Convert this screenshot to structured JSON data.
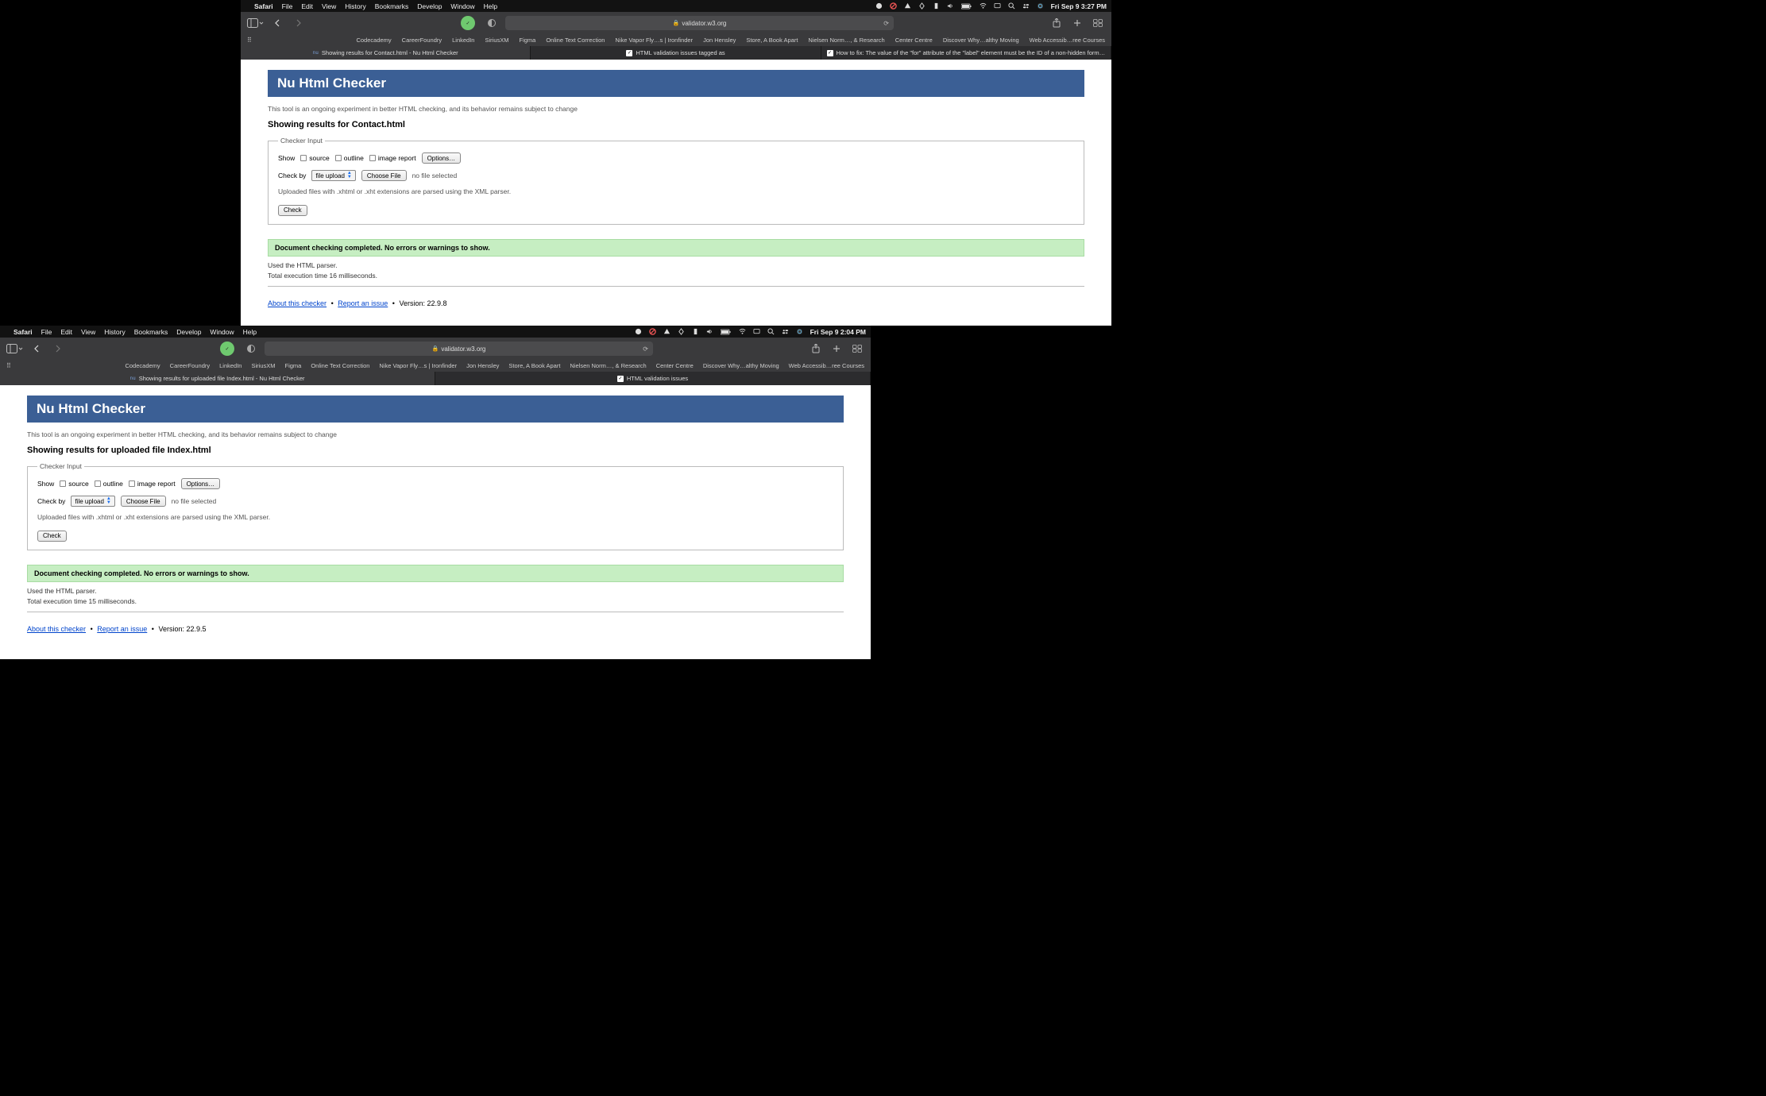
{
  "menubar": {
    "app": "Safari",
    "items": [
      "File",
      "Edit",
      "View",
      "History",
      "Bookmarks",
      "Develop",
      "Window",
      "Help"
    ]
  },
  "datetime1": "Fri Sep 9  3:27 PM",
  "datetime2": "Fri Sep 9  2:04 PM",
  "url": "validator.w3.org",
  "favorites": [
    "Codecademy",
    "CareerFoundry",
    "LinkedIn",
    "SiriusXM",
    "Figma",
    "Online Text Correction",
    "Nike Vapor Fly…s | Ironfinder",
    "Jon Hensley",
    "Store, A Book Apart",
    "Nielsen Norm…, & Research",
    "Center Centre",
    "Discover Why…althy Moving",
    "Web Accessib…ree Courses"
  ],
  "tabs1": [
    {
      "label": "Showing results for Contact.html - Nu Html Checker",
      "kind": "nu",
      "active": true
    },
    {
      "label": "HTML validation issues tagged as",
      "kind": "check",
      "active": false
    },
    {
      "label": "How to fix: The value of the \"for\" attribute of the \"label\" element must be the ID of a non-hidden form…",
      "kind": "check",
      "active": false
    }
  ],
  "tabs2": [
    {
      "label": "Showing results for uploaded file Index.html - Nu Html Checker",
      "kind": "nu",
      "active": true
    },
    {
      "label": "HTML validation issues",
      "kind": "check",
      "active": false
    }
  ],
  "nu": {
    "title": "Nu Html Checker",
    "tagline": "This tool is an ongoing experiment in better HTML checking, and its behavior remains subject to change",
    "legend": "Checker Input",
    "show_label": "Show",
    "opt_source": "source",
    "opt_outline": "outline",
    "opt_image": "image report",
    "options_btn": "Options…",
    "checkby_label": "Check by",
    "checkby_value": "file upload",
    "choose_file": "Choose File",
    "no_file": "no file selected",
    "xhtml_note": "Uploaded files with .xhtml or .xht extensions are parsed using the XML parser.",
    "check_btn": "Check",
    "success": "Document checking completed. No errors or warnings to show.",
    "parser": "Used the HTML parser.",
    "about": "About this checker",
    "report": "Report an issue"
  },
  "page1": {
    "results_heading": "Showing results for Contact.html",
    "exec": "Total execution time 16 milliseconds.",
    "version": "Version: 22.9.8"
  },
  "page2": {
    "results_heading": "Showing results for uploaded file Index.html",
    "exec": "Total execution time 15 milliseconds.",
    "version": "Version: 22.9.5"
  }
}
